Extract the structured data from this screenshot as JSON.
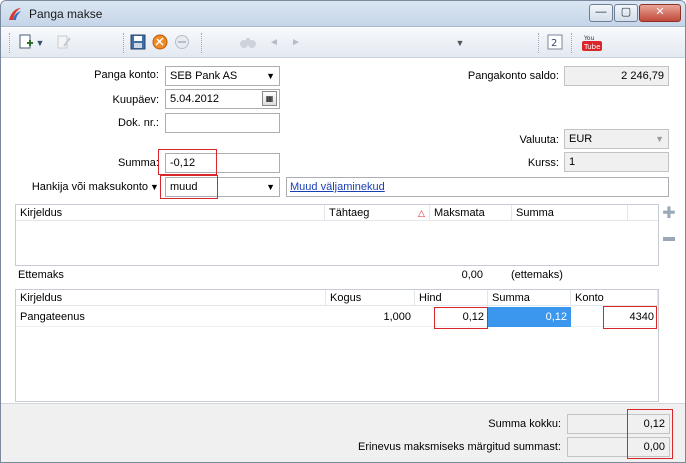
{
  "window": {
    "title": "Panga makse"
  },
  "title_controls": {
    "minimize": "—",
    "maximize": "▢",
    "close": "✕"
  },
  "toolbar": {
    "icons": [
      "new-doc-icon",
      "dropdown-arrow",
      "edit-icon",
      "save-icon",
      "cancel-icon",
      "remove-icon",
      "binoculars-icon",
      "prev-icon",
      "next-icon",
      "menu-dropdown",
      "refresh-icon",
      "youtube-icon"
    ],
    "youtube_label": "You Tube"
  },
  "form": {
    "bank_account": {
      "label": "Panga konto:",
      "value": "SEB Pank AS"
    },
    "date": {
      "label": "Kuupäev:",
      "value": "5.04.2012"
    },
    "doc_no": {
      "label": "Dok. nr.:",
      "value": ""
    },
    "bank_balance": {
      "label": "Pangakonto saldo:",
      "value": "2 246,79"
    },
    "currency": {
      "label": "Valuuta:",
      "value": "EUR"
    },
    "rate": {
      "label": "Kurss:",
      "value": "1"
    },
    "sum": {
      "label": "Summa:",
      "value": "-0,12"
    },
    "supplier": {
      "label": "Hankija või maksukonto",
      "value": "muud"
    },
    "link": "Muud väljaminekud"
  },
  "invoice_grid": {
    "columns": [
      "Kirjeldus",
      "Tähtaeg",
      "Maksmata",
      "Summa"
    ],
    "sort_icon": "△"
  },
  "advance": {
    "label": "Ettemaks",
    "value": "0,00",
    "note": "(ettemaks)"
  },
  "lines_grid": {
    "columns": [
      "Kirjeldus",
      "Kogus",
      "Hind",
      "Summa",
      "Konto"
    ],
    "rows": [
      {
        "description": "Pangateenus",
        "quantity": "1,000",
        "price": "0,12",
        "sum": "0,12",
        "account": "4340"
      }
    ]
  },
  "totals": {
    "total": {
      "label": "Summa kokku:",
      "value": "0,12"
    },
    "difference": {
      "label": "Erinevus maksmiseks märgitud summast:",
      "value": "0,00"
    }
  },
  "colors": {
    "accent": "#3b96ee",
    "highlight_border": "#d9262b",
    "link": "#1a3fb4"
  }
}
